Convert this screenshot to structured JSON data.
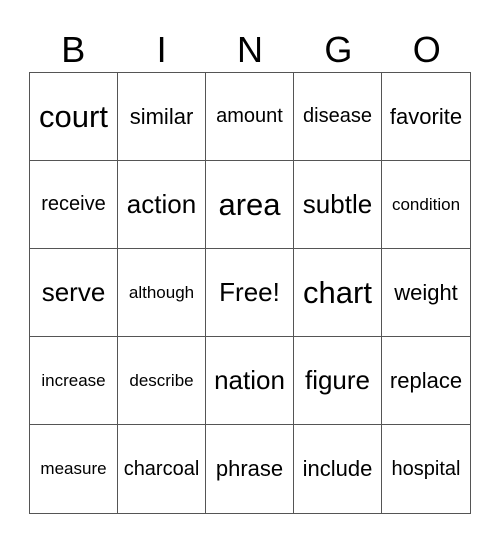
{
  "header": {
    "letters": [
      "B",
      "I",
      "N",
      "G",
      "O"
    ]
  },
  "card": {
    "cells": [
      {
        "text": "court",
        "size": "xl"
      },
      {
        "text": "similar",
        "size": "m"
      },
      {
        "text": "amount",
        "size": "s"
      },
      {
        "text": "disease",
        "size": "s"
      },
      {
        "text": "favorite",
        "size": "m"
      },
      {
        "text": "receive",
        "size": "s"
      },
      {
        "text": "action",
        "size": "l"
      },
      {
        "text": "area",
        "size": "xl"
      },
      {
        "text": "subtle",
        "size": "l"
      },
      {
        "text": "condition",
        "size": "xs"
      },
      {
        "text": "serve",
        "size": "l"
      },
      {
        "text": "although",
        "size": "xs"
      },
      {
        "text": "Free!",
        "size": "l"
      },
      {
        "text": "chart",
        "size": "xl"
      },
      {
        "text": "weight",
        "size": "m"
      },
      {
        "text": "increase",
        "size": "xs"
      },
      {
        "text": "describe",
        "size": "xs"
      },
      {
        "text": "nation",
        "size": "l"
      },
      {
        "text": "figure",
        "size": "l"
      },
      {
        "text": "replace",
        "size": "m"
      },
      {
        "text": "measure",
        "size": "xs"
      },
      {
        "text": "charcoal",
        "size": "s"
      },
      {
        "text": "phrase",
        "size": "m"
      },
      {
        "text": "include",
        "size": "m"
      },
      {
        "text": "hospital",
        "size": "s"
      }
    ]
  }
}
